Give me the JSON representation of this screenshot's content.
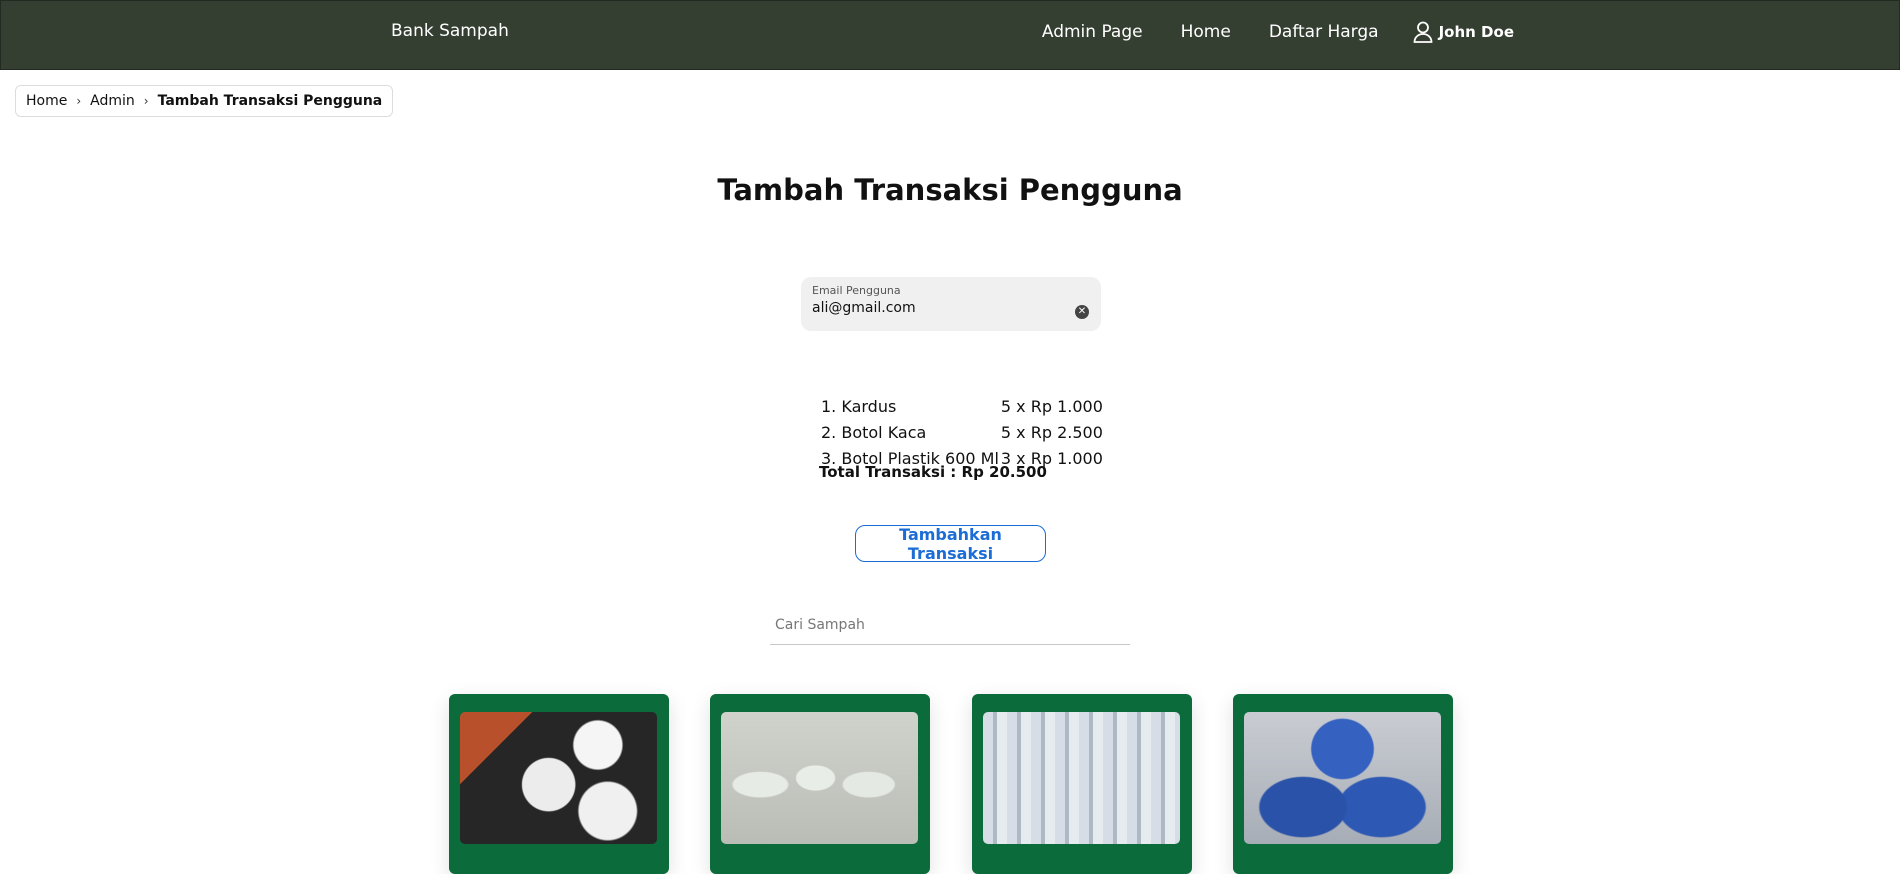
{
  "navbar": {
    "brand": "Bank Sampah",
    "links": [
      "Admin Page",
      "Home",
      "Daftar Harga"
    ],
    "user_name": "John Doe",
    "user_icon": "user-icon"
  },
  "breadcrumb": {
    "items": [
      "Home",
      "Admin"
    ],
    "current": "Tambah Transaksi Pengguna"
  },
  "page_title": "Tambah Transaksi Pengguna",
  "email_field": {
    "label": "Email Pengguna",
    "value": "ali@gmail.com",
    "clear_icon": "clear-icon"
  },
  "transaction": {
    "items": [
      {
        "name": "1. Kardus",
        "qty_price": "5 x Rp 1.000"
      },
      {
        "name": "2. Botol Kaca",
        "qty_price": "5 x Rp 2.500"
      },
      {
        "name": "3. Botol Plastik 600 Ml",
        "qty_price": "3 x Rp 1.000"
      }
    ],
    "total": "Total Transaksi : Rp 20.500"
  },
  "add_button": "Tambahkan Transaksi",
  "search": {
    "placeholder": "Cari Sampah"
  },
  "colors": {
    "navbar": "#343f32",
    "card": "#0b6b3a",
    "button_accent": "#1c6cd6"
  }
}
